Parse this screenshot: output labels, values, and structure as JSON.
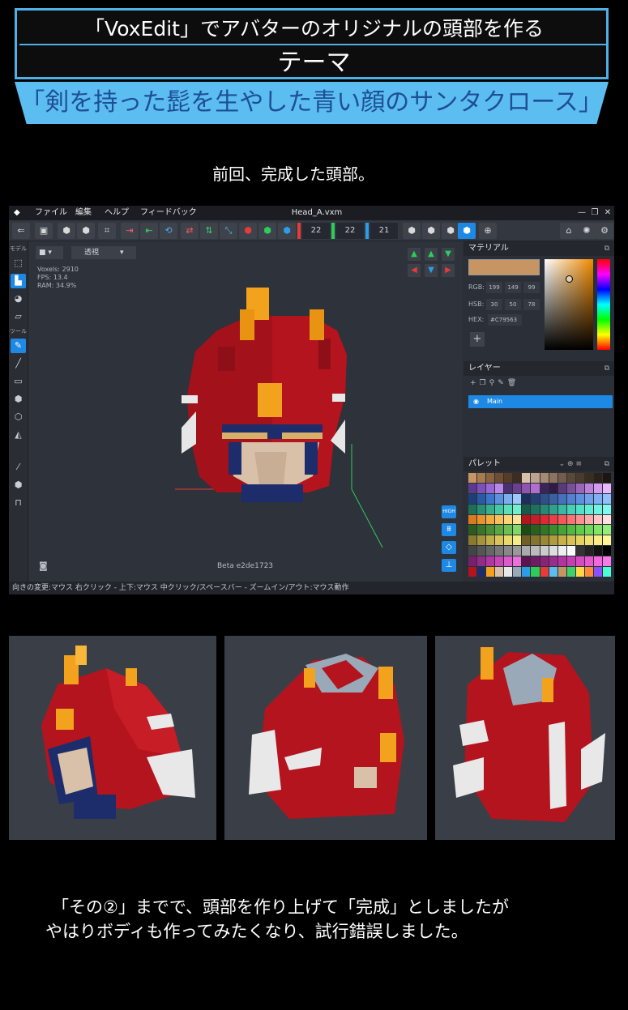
{
  "banner": {
    "line1": "「VoxEdit」でアバターのオリジナルの頭部を作る",
    "line2": "テーマ",
    "theme": "「剣を持った髭を生やした青い顔のサンタクロース」"
  },
  "caption_top": "前回、完成した頭部。",
  "app": {
    "menu": [
      "ファイル",
      "編集",
      "ヘルプ",
      "フィードバック"
    ],
    "window_title": "Head_A.vxm",
    "toolbar_numbers": [
      "22",
      "22",
      "21"
    ],
    "left_tools": {
      "model_label": "モデル",
      "tool_label": "ツール"
    },
    "viewport": {
      "view_mode": "透視",
      "stats": [
        "Voxels: 2910",
        "FPS: 13.4",
        "RAM: 34.9%"
      ],
      "side_button_label": "HIGH",
      "version": "Beta e2de1723"
    },
    "status": "向きの変更:マウス 右クリック - 上下:マウス 中クリック/スペースバー - ズームイン/アウト:マウス動作",
    "material": {
      "title": "マテリアル",
      "rgb_label": "RGB:",
      "rgb": [
        "199",
        "149",
        "99"
      ],
      "hsb_label": "HSB:",
      "hsb": [
        "30",
        "50",
        "78"
      ],
      "hex_label": "HEX:",
      "hex": "#C79563",
      "color": "#c79563"
    },
    "layers": {
      "title": "レイヤー",
      "items": [
        "Main"
      ]
    },
    "palette": {
      "title": "パレット"
    }
  },
  "caption_bottom_1": "「その②」までで、頭部を作り上げて「完成」としましたが",
  "caption_bottom_2": "やはりボディも作ってみたくなり、試行錯誤しました。",
  "colors": {
    "accent_blue": "#1e88e5",
    "banner_blue": "#5cbdf0",
    "voxel_red": "#b3141e",
    "voxel_orange": "#f2a21c",
    "voxel_navy": "#1d2c6b",
    "voxel_skin": "#d9c0a8"
  }
}
